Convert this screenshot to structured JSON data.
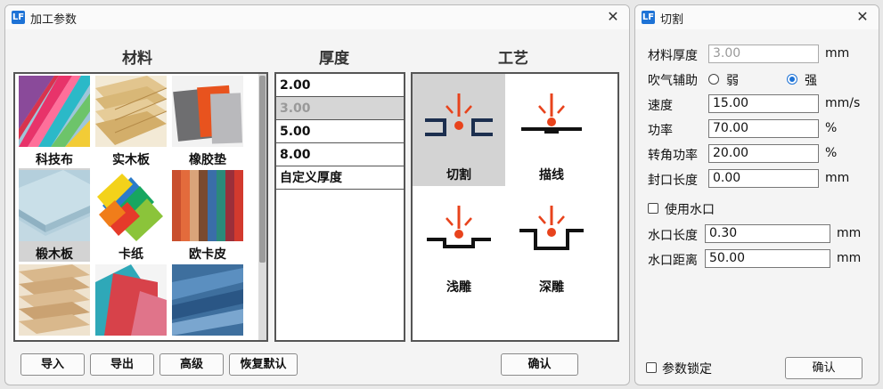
{
  "params_dialog": {
    "title": "加工参数",
    "headers": {
      "material": "材料",
      "thickness": "厚度",
      "process": "工艺"
    },
    "materials": [
      {
        "label": "科技布",
        "icon": "tech-fabric-swatch"
      },
      {
        "label": "实木板",
        "icon": "solid-wood-swatch"
      },
      {
        "label": "橡胶垫",
        "icon": "rubber-pad-swatch"
      },
      {
        "label": "椴木板",
        "icon": "basswood-swatch"
      },
      {
        "label": "卡纸",
        "icon": "cardstock-swatch"
      },
      {
        "label": "欧卡皮",
        "icon": "leather-swatch"
      },
      {
        "label": "",
        "icon": "plywood-swatch"
      },
      {
        "label": "",
        "icon": "red-leather-swatch"
      },
      {
        "label": "",
        "icon": "denim-swatch"
      }
    ],
    "selected_material": "椴木板",
    "thicknesses": [
      "2.00",
      "3.00",
      "5.00",
      "8.00",
      "自定义厚度"
    ],
    "selected_thickness": "3.00",
    "processes": [
      {
        "label": "切割",
        "icon": "laser-cut-icon"
      },
      {
        "label": "描线",
        "icon": "laser-line-icon"
      },
      {
        "label": "浅雕",
        "icon": "laser-shallow-engrave-icon"
      },
      {
        "label": "深雕",
        "icon": "laser-deep-engrave-icon"
      }
    ],
    "selected_process": "切割",
    "buttons": {
      "import": "导入",
      "export": "导出",
      "advanced": "高级",
      "restore": "恢复默认",
      "confirm": "确认"
    }
  },
  "cut_dialog": {
    "title": "切割",
    "fields": {
      "thickness": {
        "label": "材料厚度",
        "value": "3.00",
        "unit": "mm"
      },
      "air_assist": {
        "label": "吹气辅助",
        "options": [
          "弱",
          "强"
        ],
        "selected": "强"
      },
      "speed": {
        "label": "速度",
        "value": "15.00",
        "unit": "mm/s"
      },
      "power": {
        "label": "功率",
        "value": "70.00",
        "unit": "%"
      },
      "corner_power": {
        "label": "转角功率",
        "value": "20.00",
        "unit": "%"
      },
      "seal_length": {
        "label": "封口长度",
        "value": "0.00",
        "unit": "mm"
      },
      "use_water_port": {
        "label": "使用水口",
        "checked": false
      },
      "water_port_length": {
        "label": "水口长度",
        "value": "0.30",
        "unit": "mm"
      },
      "water_port_distance": {
        "label": "水口距离",
        "value": "50.00",
        "unit": "mm"
      },
      "param_lock": {
        "label": "参数锁定",
        "checked": false
      }
    },
    "confirm": "确认"
  },
  "colors": {
    "accent": "#1e73d6",
    "laser_red": "#e8431c",
    "cut_blue": "#1c2f4f"
  }
}
